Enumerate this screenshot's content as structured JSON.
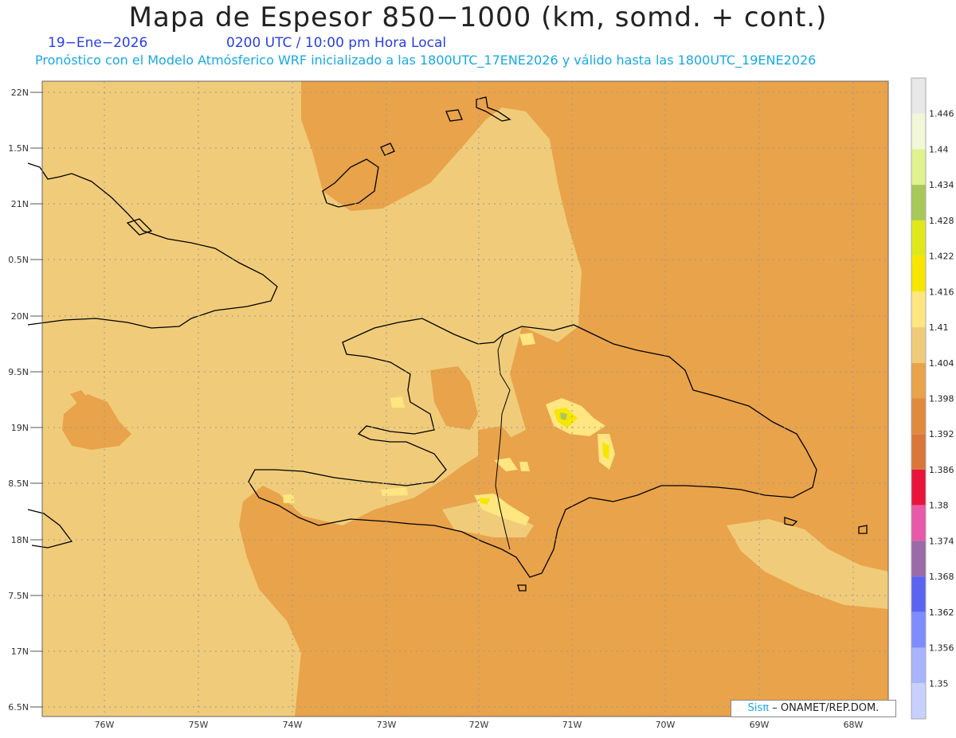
{
  "title": "Mapa de Espesor 850−1000 (km, somd. + cont.)",
  "date": "19−Ene−2026",
  "time": "0200 UTC / 10:00 pm Hora Local",
  "forecast": "Pronóstico con el Modelo Atmósferico WRF inicializado a las 1800UTC_17ENE2026 y válido hasta las  1800UTC_19ENE2026",
  "credit_brand": "Sisπ",
  "credit_rest": "– ONAMET/REP.DOM.",
  "colors": {
    "low": "#f0cc7a",
    "mid": "#e9a34a",
    "dark": "#df8a3d",
    "yellow_light": "#ffe680",
    "yellow": "#f7e600",
    "green": "#a8c85a",
    "coast": "#000000"
  },
  "lat_labels": [
    "22N",
    "1.5N",
    "21N",
    "0.5N",
    "20N",
    "9.5N",
    "19N",
    "8.5N",
    "18N",
    "7.5N",
    "17N",
    "6.5N"
  ],
  "lon_labels": [
    "76W",
    "75W",
    "74W",
    "73W",
    "72W",
    "71W",
    "70W",
    "69W",
    "68W"
  ],
  "colorbar": {
    "labels": [
      "1.446",
      "1.44",
      "1.434",
      "1.428",
      "1.422",
      "1.416",
      "1.41",
      "1.404",
      "1.398",
      "1.392",
      "1.386",
      "1.38",
      "1.374",
      "1.368",
      "1.362",
      "1.356",
      "1.35"
    ],
    "colors": [
      "#e8e8e8",
      "#f2f7d8",
      "#e0f28c",
      "#a8c85a",
      "#e0e81a",
      "#f7e600",
      "#ffe680",
      "#f0cc7a",
      "#e9a34a",
      "#df8a3d",
      "#d9773a",
      "#e8143c",
      "#e85aa8",
      "#9b6aa8",
      "#5a64f0",
      "#7f8cff",
      "#a8b4ff",
      "#c8d0ff"
    ]
  }
}
